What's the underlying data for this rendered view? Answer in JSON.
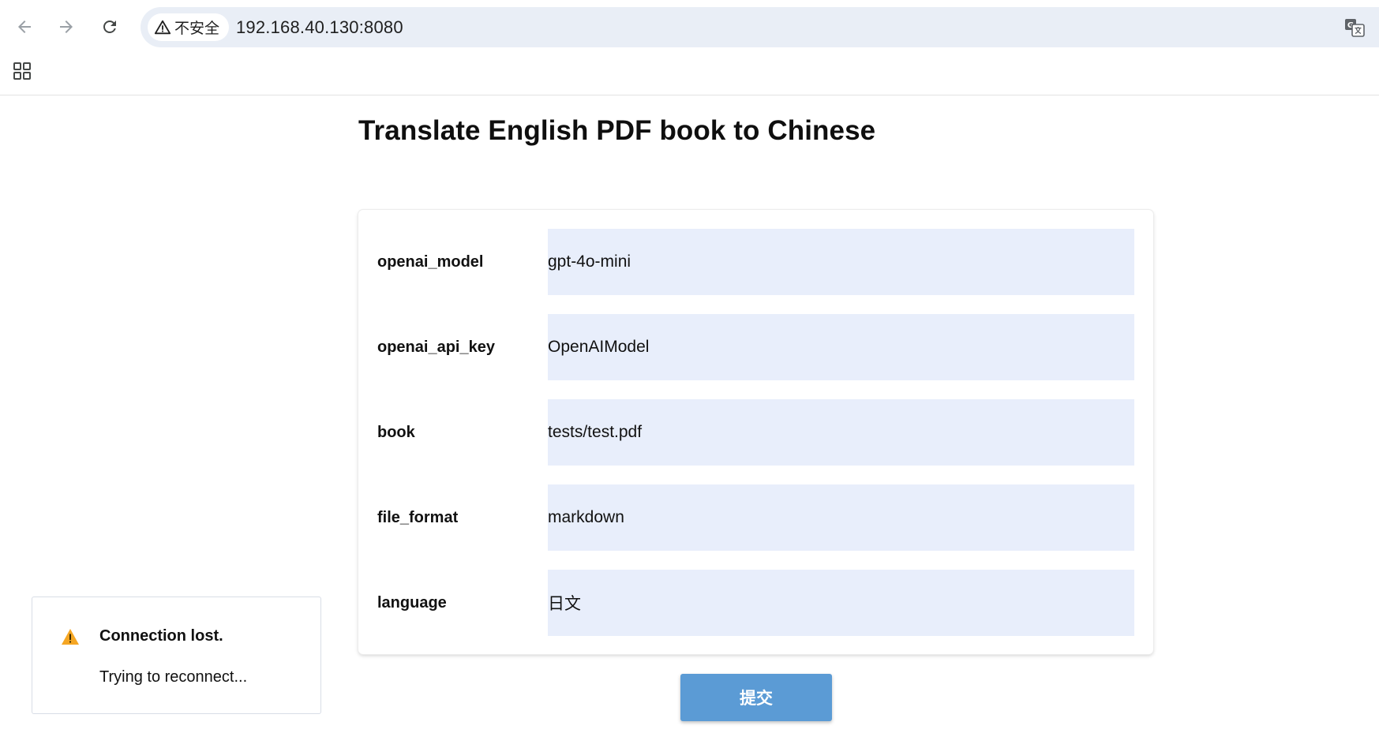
{
  "browser": {
    "security_label": "不安全",
    "url": "192.168.40.130:8080"
  },
  "page": {
    "title": "Translate English PDF book to Chinese"
  },
  "form": {
    "fields": [
      {
        "label": "openai_model",
        "value": "gpt-4o-mini"
      },
      {
        "label": "openai_api_key",
        "value": "OpenAIModel"
      },
      {
        "label": "book",
        "value": "tests/test.pdf"
      },
      {
        "label": "file_format",
        "value": "markdown"
      },
      {
        "label": "language",
        "value": "日文"
      }
    ],
    "submit_label": "提交"
  },
  "toast": {
    "title": "Connection lost.",
    "message": "Trying to reconnect..."
  },
  "colors": {
    "field_background": "#e8eefb",
    "submit_button": "#5b9bd5",
    "warning": "#f5a623",
    "omnibox": "#e9eef6"
  },
  "icons": {
    "back": "back-arrow-icon",
    "forward": "forward-arrow-icon",
    "reload": "reload-icon",
    "security": "warning-triangle-icon",
    "translate": "translate-icon",
    "apps": "apps-grid-icon",
    "toast": "warning-icon"
  }
}
